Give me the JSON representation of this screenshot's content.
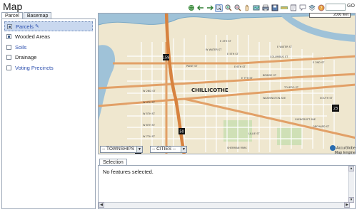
{
  "window": {
    "title": "Map"
  },
  "toolbar": {
    "icons": [
      "globe-icon",
      "back-arrow-icon",
      "forward-arrow-icon",
      "select-icon",
      "zoom-in-icon",
      "zoom-out-icon",
      "pan-icon",
      "full-extent-icon",
      "print-icon",
      "save-icon",
      "measure-icon",
      "identify-icon",
      "note-icon",
      "layers-icon",
      "help-icon"
    ],
    "search_value": "",
    "go_label": "GO"
  },
  "tabs": [
    "Parcel",
    "Basemap"
  ],
  "layers": [
    {
      "label": "Parcels",
      "checked": true,
      "selected": true,
      "link": true
    },
    {
      "label": "Wooded Areas",
      "checked": true,
      "selected": false,
      "link": false
    },
    {
      "label": "Soils",
      "checked": false,
      "selected": false,
      "link": true
    },
    {
      "label": "Drainage",
      "checked": false,
      "selected": false,
      "link": false
    },
    {
      "label": "Voting Precincts",
      "checked": false,
      "selected": false,
      "link": true
    }
  ],
  "map": {
    "city_label": "CHILLICOTHE",
    "scale_label": "2000 feet",
    "street_labels": [
      "W WATER ST",
      "E WATER ST",
      "E 2ND ST",
      "E 4TH ST",
      "E 5TH ST",
      "E 6TH ST",
      "W 2ND ST",
      "W 4TH ST",
      "W 5TH ST",
      "W 6TH ST",
      "W 7TH ST",
      "E 7TH ST",
      "WASHINGTON AVE",
      "PAINT ST",
      "LILLIE ST",
      "SHERMAN PARK",
      "GLENCROFT AVE",
      "COLUMBUS ST",
      "BRIDGE ST",
      "ORCHARD ST",
      "TOLEDO ST",
      "SOUTH ST"
    ],
    "shields": [
      "23",
      "50",
      "159",
      "23"
    ],
    "townships_placeholder": "-- TOWNSHIPS --",
    "cities_placeholder": "-- CITIES --",
    "logo_line1": "AccuGlobe",
    "logo_line2": "Map Engine"
  },
  "selection": {
    "tab_label": "Selection",
    "message": "No features selected."
  },
  "colors": {
    "panel_border": "#9aa6b6",
    "selected_layer_bg": "#c9d8ef",
    "link": "#2c4fae",
    "river": "#9fc2d8",
    "road": "#e2a067"
  }
}
